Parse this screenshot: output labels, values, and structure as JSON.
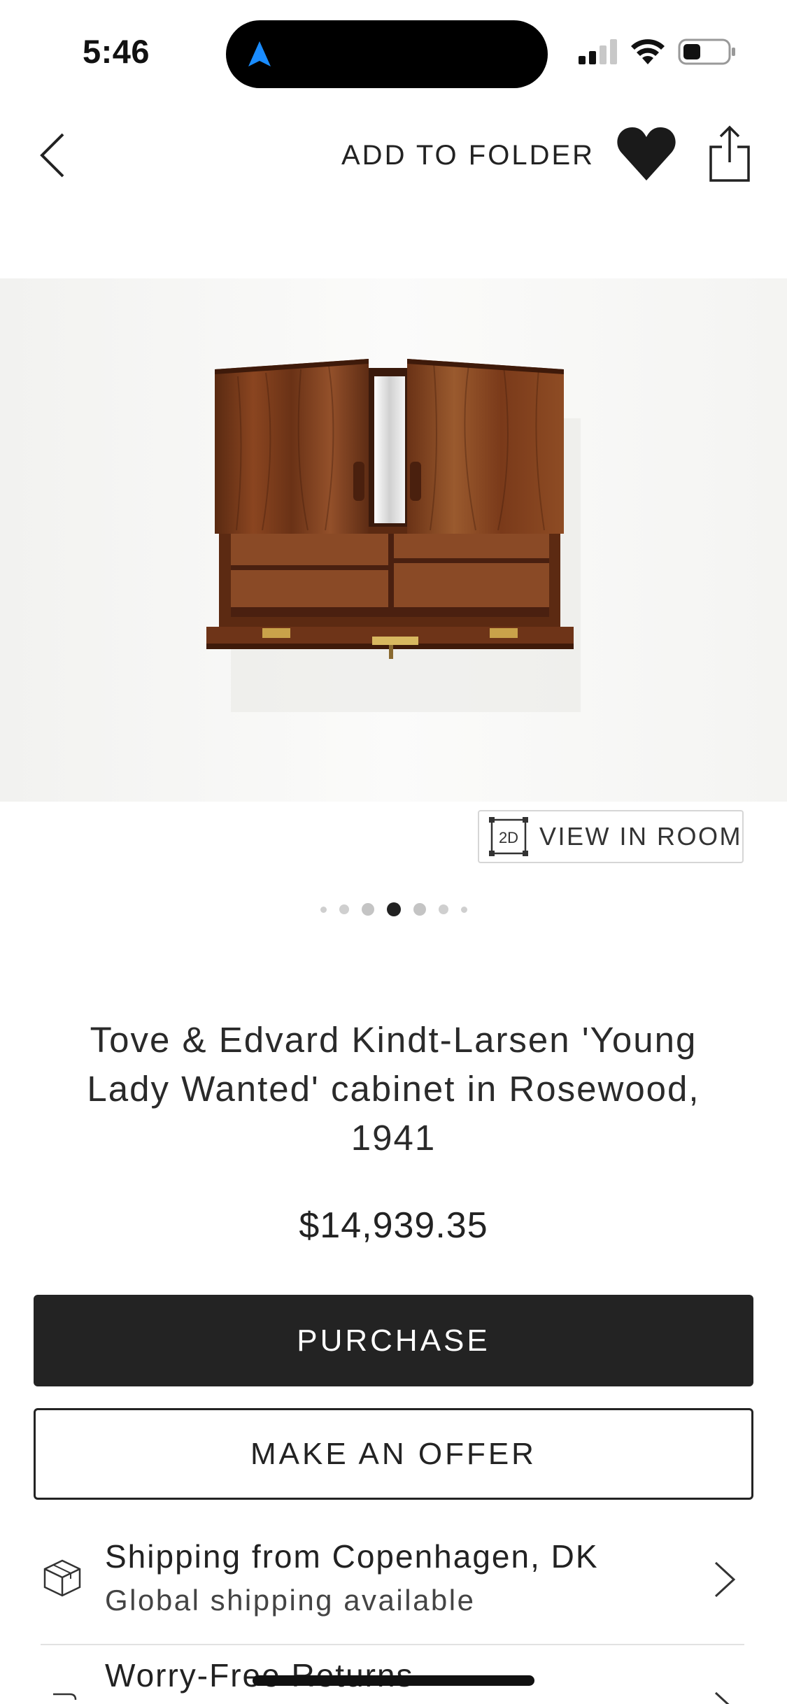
{
  "status_bar": {
    "time": "5:46"
  },
  "top_nav": {
    "add_to_folder": "ADD TO FOLDER"
  },
  "hero": {
    "view_in_room_icon_text": "2D",
    "view_in_room_label": "VIEW IN ROOM",
    "carousel": {
      "total": 7,
      "active_index": 3
    }
  },
  "product": {
    "title": "Tove & Edvard Kindt-Larsen 'Young Lady Wanted' cabinet in Rosewood, 1941",
    "price": "$14,939.35"
  },
  "actions": {
    "purchase_label": "PURCHASE",
    "offer_label": "MAKE AN OFFER"
  },
  "shipping": {
    "title": "Shipping from Copenhagen, DK",
    "subtitle": "Global shipping available"
  },
  "returns": {
    "title": "Worry-Free Returns"
  },
  "colors": {
    "accent_arrow": "#1a8cff",
    "dark_button": "#232323"
  },
  "icons": {
    "back": "chevron-left-icon",
    "favorite": "heart-icon",
    "share": "share-icon",
    "shipping": "box-icon",
    "returns": "return-icon"
  }
}
